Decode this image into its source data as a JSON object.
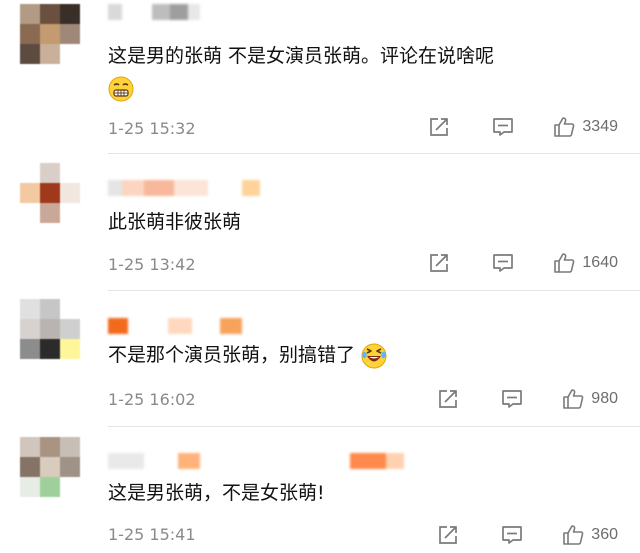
{
  "comments": [
    {
      "text": "这是男的张萌 不是女演员张萌。评论在说啥呢",
      "emoji": "grimace-face-emoji",
      "time": "1-25 15:32",
      "likes": "3349",
      "avatar_colors": [
        "#b39a84",
        "#6b5040",
        "#3a2e28",
        "#8a6a52",
        "#c49a70",
        "#a08878",
        "#5d4b40",
        "#c8b09a",
        "#ffffff"
      ],
      "name_colors": [
        "#d9d9d9",
        "#bdbdbd",
        "#9e9e9e",
        "#e8e8e8"
      ]
    },
    {
      "text": "此张萌非彼张萌",
      "time": "1-25 13:42",
      "likes": "1640",
      "avatar_colors": [
        "#ffffff",
        "#d9cfc8",
        "#ffffff",
        "#f2c9a0",
        "#a0381c",
        "#f0e7e0",
        "#ffffff",
        "#c9a897",
        "#ffffff"
      ],
      "name_colors": [
        "#fbd5c2",
        "#f7b89c",
        "#fce4d6",
        "#e5e5e5",
        "#ffffff",
        "#ffd39a"
      ]
    },
    {
      "text": "不是那个演员张萌，别搞错了",
      "emoji": "laughing-tears-emoji",
      "time": "1-25 16:02",
      "likes": "980",
      "avatar_colors": [
        "#e0e0e0",
        "#c6c6c6",
        "#ffffff",
        "#d7d2cf",
        "#b9b4b1",
        "#cfcfcf",
        "#8c8c8c",
        "#2b2b2b",
        "#fff59a"
      ],
      "name_colors": [
        "#f26b1d",
        "#ffffff",
        "#ffd8bf",
        "#ffffff",
        "#f7a35c"
      ]
    },
    {
      "text": "这是男张萌，不是女张萌!",
      "time": "1-25 15:41",
      "likes": "360",
      "avatar_colors": [
        "#d0c6bd",
        "#a99482",
        "#c7bfb6",
        "#857365",
        "#d8ccbe",
        "#9e9386",
        "#e7ece4",
        "#9fd09b",
        "#ffffff"
      ],
      "name_colors": [
        "#e9e9e9",
        "#ffb27a",
        "#ffffff",
        "#ff8a4b",
        "#ffd1b0"
      ]
    }
  ],
  "icons": {
    "share": "share-icon",
    "reply": "comment-icon",
    "like": "thumbs-up-icon"
  },
  "colors": {
    "text": "#111111",
    "meta": "#8a8a8a",
    "icon": "#7a7a7a",
    "divider": "#e4e4e4"
  }
}
